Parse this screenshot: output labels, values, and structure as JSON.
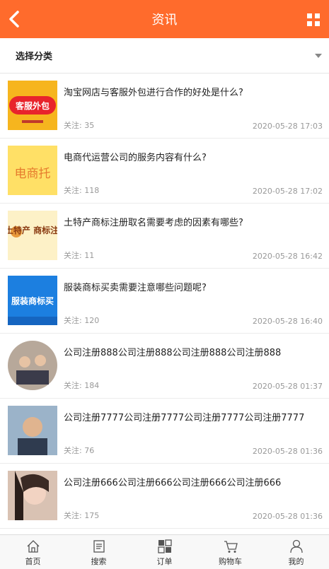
{
  "header": {
    "title": "资讯",
    "back_icon": "chevron-left-icon",
    "menu_icon": "grid-icon"
  },
  "filter": {
    "label": "选择分类"
  },
  "articles": [
    {
      "title": "淘宝网店与客服外包进行合作的好处是什么?",
      "follow_label": "关注:",
      "follows": "35",
      "date": "2020-05-28 17:03",
      "thumb_text": "客服外包"
    },
    {
      "title": "电商代运营公司的服务内容有什么?",
      "follow_label": "关注:",
      "follows": "118",
      "date": "2020-05-28 17:02",
      "thumb_text": "电商托"
    },
    {
      "title": "土特产商标注册取名需要考虑的因素有哪些?",
      "follow_label": "关注:",
      "follows": "11",
      "date": "2020-05-28 16:42",
      "thumb_text": "土特产 商标注册"
    },
    {
      "title": "服装商标买卖需要注意哪些问题呢?",
      "follow_label": "关注:",
      "follows": "120",
      "date": "2020-05-28 16:40",
      "thumb_text": "服装商标买"
    },
    {
      "title": "公司注册888公司注册888公司注册888公司注册888",
      "follow_label": "关注:",
      "follows": "184",
      "date": "2020-05-28 01:37",
      "thumb_text": ""
    },
    {
      "title": "公司注册7777公司注册7777公司注册7777公司注册7777",
      "follow_label": "关注:",
      "follows": "76",
      "date": "2020-05-28 01:36",
      "thumb_text": ""
    },
    {
      "title": "公司注册666公司注册666公司注册666公司注册666",
      "follow_label": "关注:",
      "follows": "175",
      "date": "2020-05-28 01:36",
      "thumb_text": ""
    }
  ],
  "tabs": [
    {
      "label": "首页",
      "icon": "home-icon"
    },
    {
      "label": "搜索",
      "icon": "document-icon"
    },
    {
      "label": "订单",
      "icon": "grid-squares-icon"
    },
    {
      "label": "购物车",
      "icon": "cart-icon"
    },
    {
      "label": "我的",
      "icon": "user-icon"
    }
  ],
  "colors": {
    "accent": "#ff6b2c"
  }
}
